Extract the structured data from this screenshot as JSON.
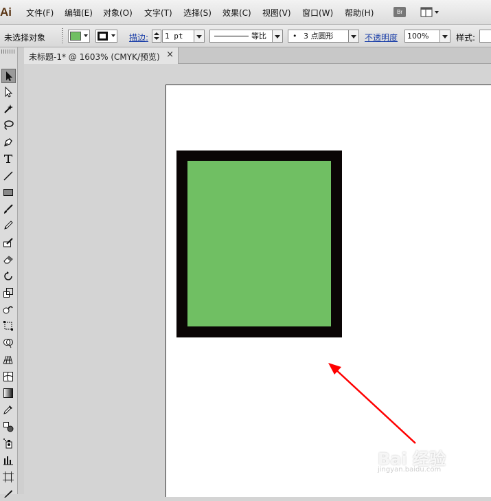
{
  "app": {
    "logo": "Ai"
  },
  "menu": [
    "文件(F)",
    "编辑(E)",
    "对象(O)",
    "文字(T)",
    "选择(S)",
    "效果(C)",
    "视图(V)",
    "窗口(W)",
    "帮助(H)"
  ],
  "toolbar_buttons": {
    "bridge": "Br"
  },
  "control_bar": {
    "selection_status": "未选择对象",
    "fill_color": "#70bf63",
    "stroke_label": "描边:",
    "stroke_weight": "1 pt",
    "stroke_profile": "等比",
    "brush": "3 点圆形",
    "brush_bullet": "•",
    "opacity_label": "不透明度",
    "opacity_value": "100%",
    "style_label": "样式:"
  },
  "document": {
    "tab_title": "未标题-1* @ 1603% (CMYK/预览)",
    "close_glyph": "×"
  },
  "artwork": {
    "rect_fill": "#70bf63",
    "rect_stroke": "#0a0505",
    "annotation_color": "#ff0000"
  },
  "watermark": {
    "main": "Bai 经验",
    "sub": "jingyan.baidu.com"
  }
}
